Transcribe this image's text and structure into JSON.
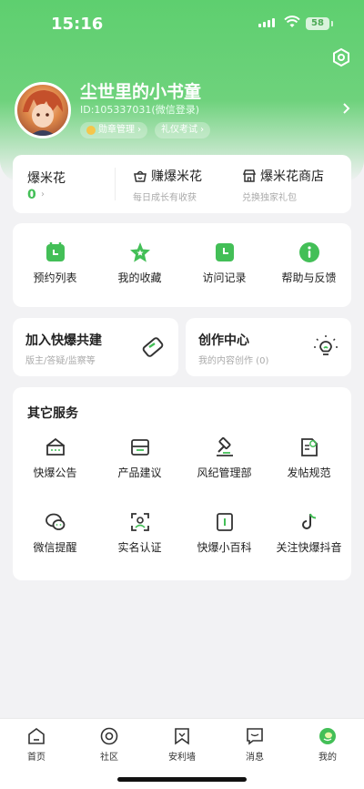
{
  "status": {
    "time": "15:16",
    "battery": "58"
  },
  "profile": {
    "nickname": "尘世里的小书童",
    "uid": "ID:105337031(微信登录)",
    "badges": [
      {
        "label": "勋章管理 ›"
      },
      {
        "label": "礼仪考试 ›"
      }
    ]
  },
  "popcorn": {
    "title": "爆米花",
    "count": "0",
    "count_arrow": "›",
    "earn": {
      "label": "赚爆米花",
      "sub": "每日成长有收获"
    },
    "shop": {
      "label": "爆米花商店",
      "sub": "兑换独家礼包"
    }
  },
  "quick_actions": [
    {
      "label": "预约列表",
      "icon": "calendar-icon"
    },
    {
      "label": "我的收藏",
      "icon": "star-icon"
    },
    {
      "label": "访问记录",
      "icon": "clock-icon"
    },
    {
      "label": "帮助与反馈",
      "icon": "info-icon"
    }
  ],
  "cards": {
    "join": {
      "title": "加入快爆共建",
      "sub": "版主/答疑/监察等"
    },
    "create": {
      "title": "创作中心",
      "sub": "我的内容创作 (0)"
    }
  },
  "services": {
    "title": "其它服务",
    "items": [
      {
        "label": "快爆公告",
        "icon": "announcement-icon"
      },
      {
        "label": "产品建议",
        "icon": "suggestion-icon"
      },
      {
        "label": "风纪管理部",
        "icon": "gavel-icon"
      },
      {
        "label": "发帖规范",
        "icon": "rules-icon"
      },
      {
        "label": "微信提醒",
        "icon": "wechat-icon"
      },
      {
        "label": "实名认证",
        "icon": "verify-icon"
      },
      {
        "label": "快爆小百科",
        "icon": "book-icon"
      },
      {
        "label": "关注快爆抖音",
        "icon": "tiktok-icon"
      }
    ]
  },
  "tabs": [
    {
      "label": "首页",
      "icon": "home-icon"
    },
    {
      "label": "社区",
      "icon": "community-icon"
    },
    {
      "label": "安利墙",
      "icon": "bookmark-icon"
    },
    {
      "label": "消息",
      "icon": "message-icon"
    },
    {
      "label": "我的",
      "icon": "me-icon",
      "active": true
    }
  ],
  "colors": {
    "accent": "#43bf57",
    "header": "#5ecf6f",
    "background": "#f2f2f4"
  }
}
